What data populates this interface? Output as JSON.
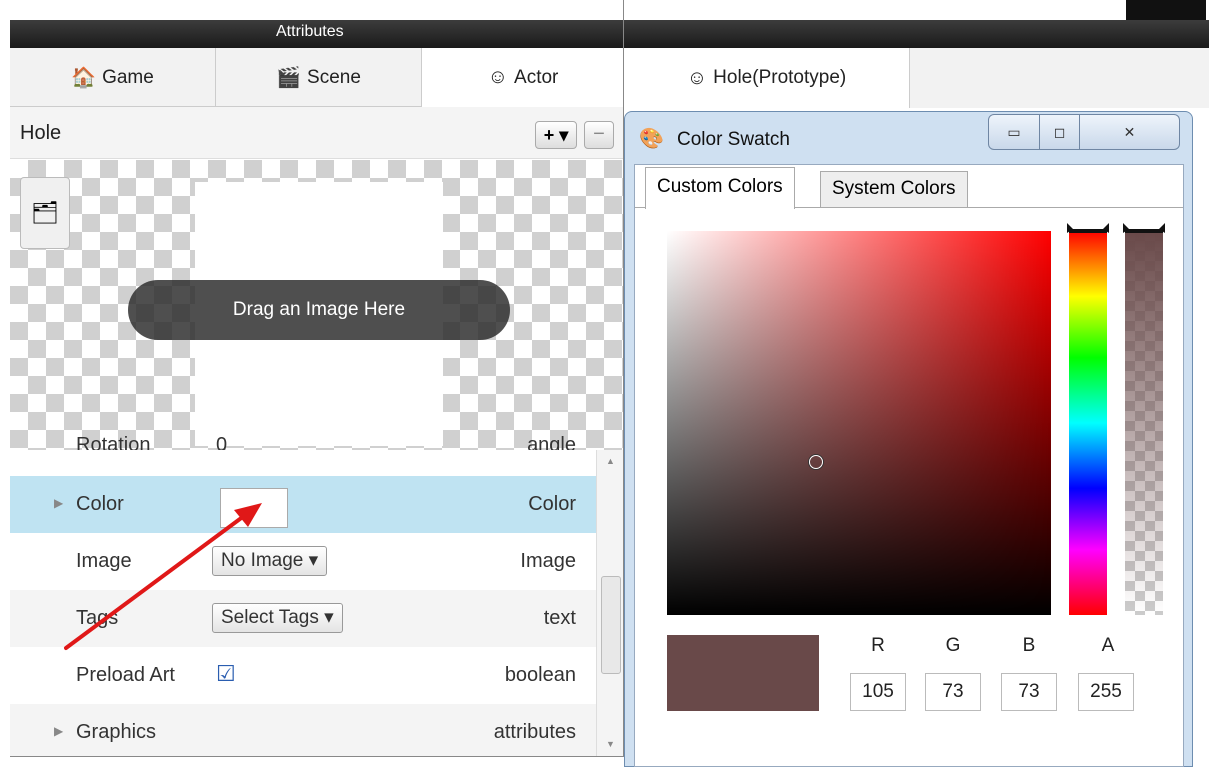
{
  "left_panel": {
    "header_title": "Attributes",
    "tabs": [
      {
        "label": "Game",
        "icon": "house-icon"
      },
      {
        "label": "Scene",
        "icon": "clapperboard-icon"
      },
      {
        "label": "Actor",
        "icon": "mask-icon"
      }
    ],
    "actor_name": "Hole",
    "add_button": "+ ▾",
    "remove_button": "−",
    "drag_image_text": "Drag an Image Here",
    "rows": [
      {
        "label": "Rotation",
        "value": "0",
        "type": "angle"
      },
      {
        "label": "Color",
        "type": "Color"
      },
      {
        "label": "Image",
        "value": "No Image ▾",
        "type": "Image"
      },
      {
        "label": "Tags",
        "value": "Select Tags ▾",
        "type": "text"
      },
      {
        "label": "Preload Art",
        "value": "☑",
        "type": "boolean"
      },
      {
        "label": "Graphics",
        "type": "attributes"
      }
    ]
  },
  "right_panel": {
    "prototype_tab": "Hole(Prototype)"
  },
  "color_swatch": {
    "title": "Color Swatch",
    "tabs": [
      "Custom Colors",
      "System Colors"
    ],
    "channels": [
      {
        "label": "R",
        "value": "105"
      },
      {
        "label": "G",
        "value": "73"
      },
      {
        "label": "B",
        "value": "73"
      },
      {
        "label": "A",
        "value": "255"
      }
    ],
    "selected_color": "#694949",
    "highlight_row_color": "#bfe3f2",
    "arrow_color": "#e01818"
  }
}
